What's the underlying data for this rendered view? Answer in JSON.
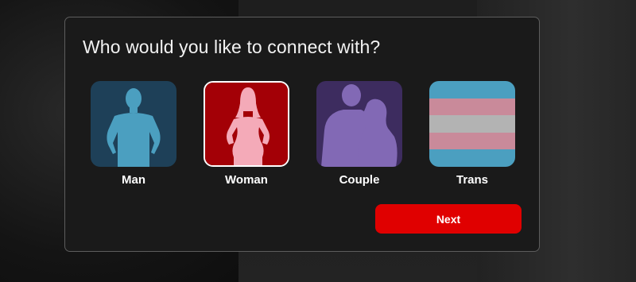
{
  "dialog": {
    "title": "Who would you like to connect with?",
    "options": [
      {
        "label": "Man",
        "icon": "man-silhouette-icon",
        "color": "#4b9fc0",
        "background": "#1e4058",
        "selected": false
      },
      {
        "label": "Woman",
        "icon": "woman-silhouette-icon",
        "color": "#f4aab8",
        "background": "#a30006",
        "selected": true
      },
      {
        "label": "Couple",
        "icon": "couple-silhouette-icon",
        "color": "#8269b5",
        "background": "#3d2c5f",
        "selected": false
      },
      {
        "label": "Trans",
        "icon": "trans-flag-icon",
        "colors": [
          "#4b9fc0",
          "#c98a9a",
          "#b3b3b3"
        ],
        "selected": false
      }
    ],
    "next_label": "Next",
    "accent": "#e00000"
  }
}
